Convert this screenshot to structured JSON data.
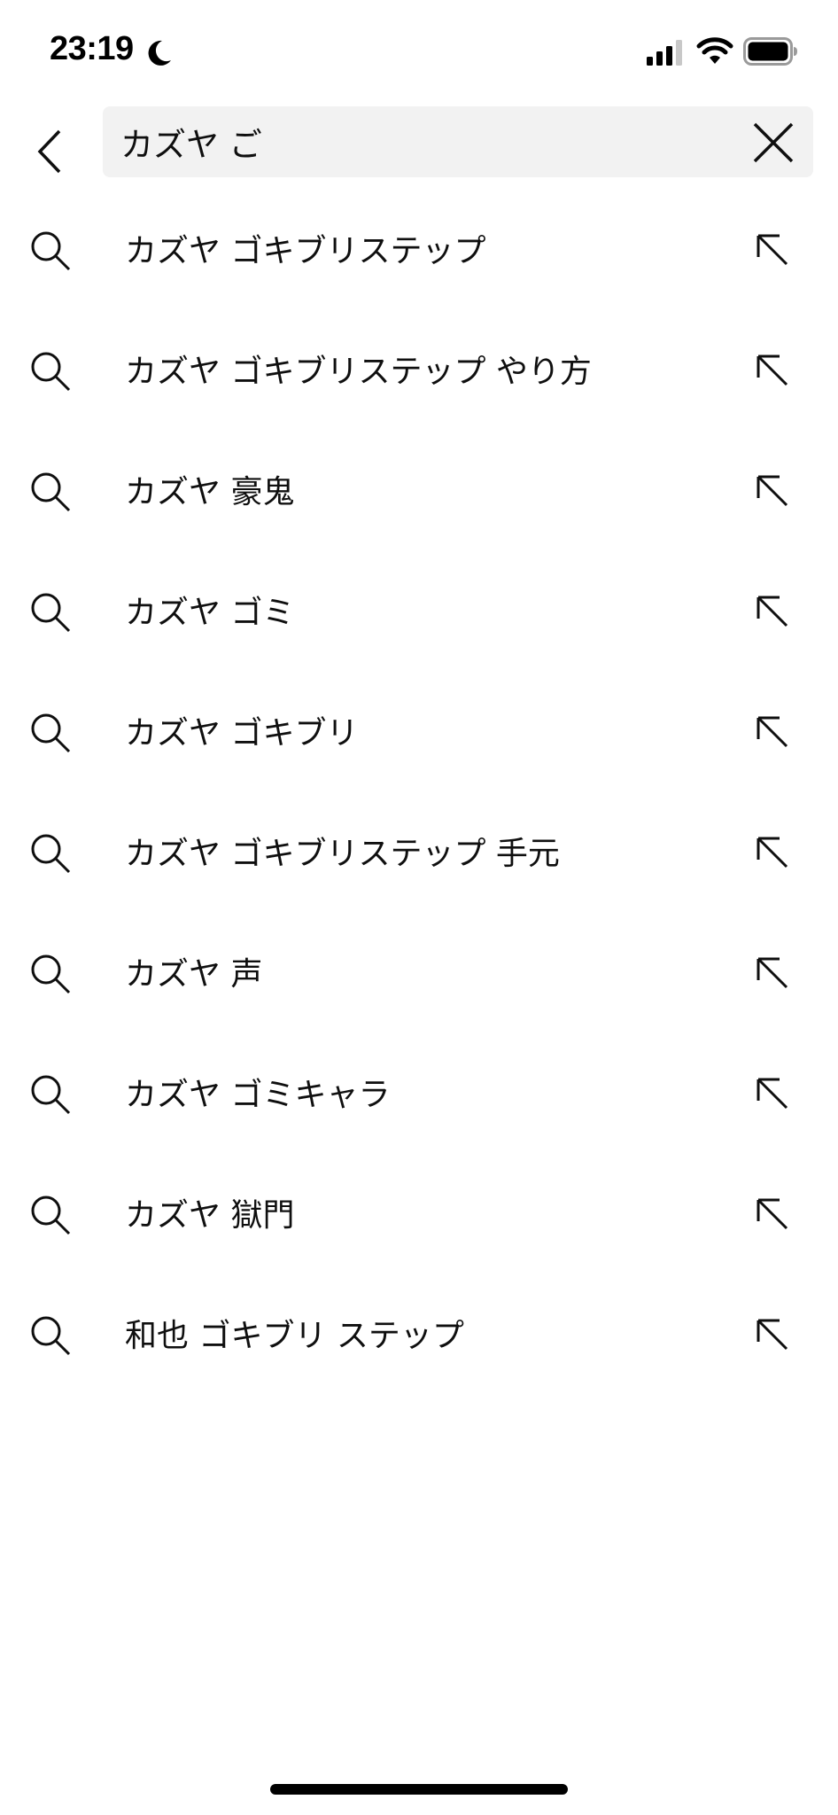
{
  "status_bar": {
    "time": "23:19",
    "icons": [
      "moon-icon",
      "cellular-signal-icon",
      "wifi-icon",
      "battery-icon"
    ]
  },
  "search": {
    "query": "カズヤ ご",
    "back_icon": "chevron-left-icon",
    "clear_icon": "close-icon"
  },
  "suggestions": [
    {
      "text": "カズヤ ゴキブリステップ"
    },
    {
      "text": "カズヤ ゴキブリステップ やり方"
    },
    {
      "text": "カズヤ 豪鬼"
    },
    {
      "text": "カズヤ ゴミ"
    },
    {
      "text": "カズヤ ゴキブリ"
    },
    {
      "text": "カズヤ ゴキブリステップ 手元"
    },
    {
      "text": "カズヤ 声"
    },
    {
      "text": "カズヤ ゴミキャラ"
    },
    {
      "text": "カズヤ 獄門"
    },
    {
      "text": "和也 ゴキブリ ステップ"
    }
  ],
  "suggestion_icons": {
    "leading": "search-icon",
    "trailing": "arrow-up-left-icon"
  },
  "colors": {
    "background": "#ffffff",
    "text": "#0f0f0f",
    "search_box": "#f2f2f2"
  }
}
